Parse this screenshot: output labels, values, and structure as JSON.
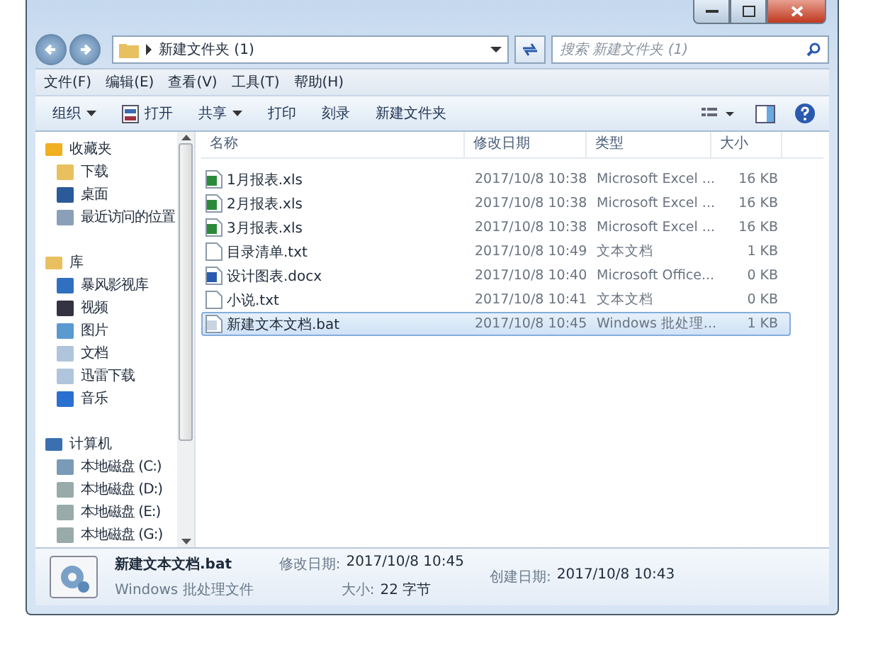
{
  "address": {
    "path": "新建文件夹 (1)"
  },
  "search": {
    "placeholder": "搜索 新建文件夹 (1)"
  },
  "menu": [
    "文件(F)",
    "编辑(E)",
    "查看(V)",
    "工具(T)",
    "帮助(H)"
  ],
  "toolbar": [
    {
      "label": "组织",
      "kind": "dropdown"
    },
    {
      "label": "打开",
      "kind": "open"
    },
    {
      "label": "共享",
      "kind": "dropdown"
    },
    {
      "label": "打印",
      "kind": "plain"
    },
    {
      "label": "刻录",
      "kind": "plain"
    },
    {
      "label": "新建文件夹",
      "kind": "plain"
    }
  ],
  "sidebar": {
    "groups": [
      {
        "label": "收藏夹",
        "kind": "star",
        "children": [
          {
            "label": "下载",
            "kind": "download"
          },
          {
            "label": "桌面",
            "kind": "desktop"
          },
          {
            "label": "最近访问的位置",
            "kind": "recent"
          }
        ]
      },
      {
        "label": "库",
        "kind": "library",
        "children": [
          {
            "label": "暴风影视库",
            "kind": "grid"
          },
          {
            "label": "视频",
            "kind": "video"
          },
          {
            "label": "图片",
            "kind": "picture"
          },
          {
            "label": "文档",
            "kind": "document"
          },
          {
            "label": "迅雷下载",
            "kind": "document"
          },
          {
            "label": "音乐",
            "kind": "music"
          }
        ]
      },
      {
        "label": "计算机",
        "kind": "computer",
        "children": [
          {
            "label": "本地磁盘 (C:)",
            "kind": "system-drive"
          },
          {
            "label": "本地磁盘 (D:)",
            "kind": "drive"
          },
          {
            "label": "本地磁盘 (E:)",
            "kind": "drive"
          },
          {
            "label": "本地磁盘 (G:)",
            "kind": "drive"
          }
        ]
      }
    ]
  },
  "table": {
    "columns": [
      "名称",
      "修改日期",
      "类型",
      "大小"
    ],
    "rows": [
      {
        "name": "1月报表.xls",
        "kind": "excel",
        "date": "2017/10/8 10:38",
        "type": "Microsoft Excel ...",
        "size": "16 KB",
        "selected": false
      },
      {
        "name": "2月报表.xls",
        "kind": "excel",
        "date": "2017/10/8 10:38",
        "type": "Microsoft Excel ...",
        "size": "16 KB",
        "selected": false
      },
      {
        "name": "3月报表.xls",
        "kind": "excel",
        "date": "2017/10/8 10:38",
        "type": "Microsoft Excel ...",
        "size": "16 KB",
        "selected": false
      },
      {
        "name": "目录清单.txt",
        "kind": "text",
        "date": "2017/10/8 10:49",
        "type": "文本文档",
        "size": "1 KB",
        "selected": false
      },
      {
        "name": "设计图表.docx",
        "kind": "word",
        "date": "2017/10/8 10:40",
        "type": "Microsoft Office...",
        "size": "0 KB",
        "selected": false
      },
      {
        "name": "小说.txt",
        "kind": "text",
        "date": "2017/10/8 10:41",
        "type": "文本文档",
        "size": "0 KB",
        "selected": false
      },
      {
        "name": "新建文本文档.bat",
        "kind": "bat",
        "date": "2017/10/8 10:45",
        "type": "Windows 批处理...",
        "size": "1 KB",
        "selected": true
      }
    ]
  },
  "details": {
    "name": "新建文本文档.bat",
    "type": "Windows 批处理文件",
    "modified_label": "修改日期:",
    "modified": "2017/10/8 10:45",
    "size_label": "大小:",
    "size": "22 字节",
    "created_label": "创建日期:",
    "created": "2017/10/8 10:43"
  }
}
